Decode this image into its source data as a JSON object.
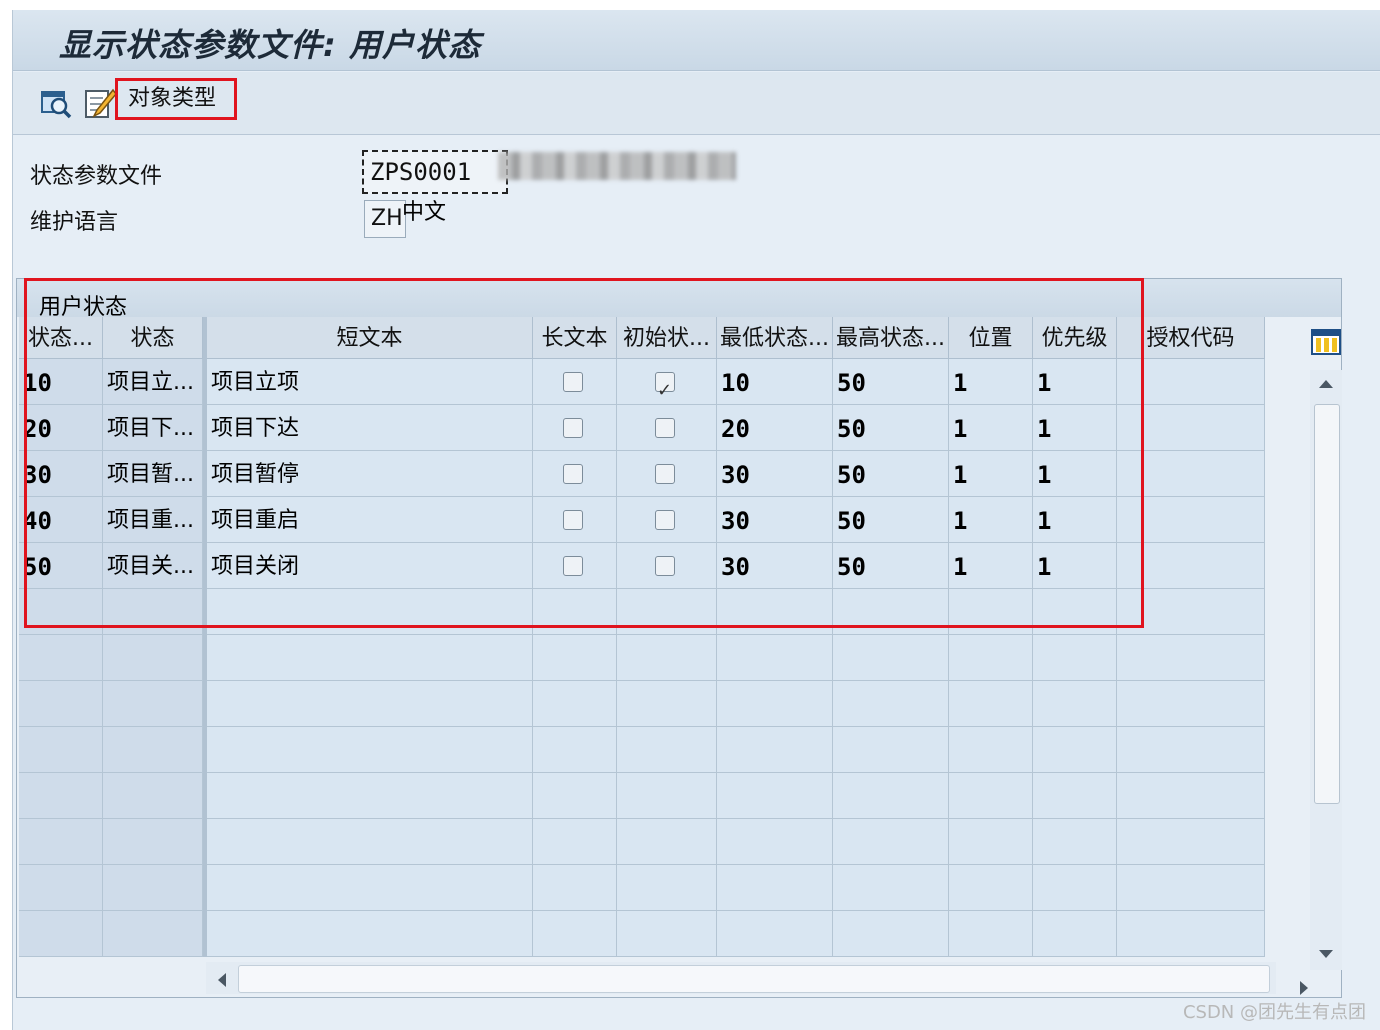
{
  "window": {
    "title": "显示状态参数文件: 用户状态"
  },
  "toolbar": {
    "icons": [
      "display-search-icon",
      "edit-pencil-icon"
    ],
    "object_type_label": "对象类型"
  },
  "form": {
    "profile_label": "状态参数文件",
    "profile_value": "ZPS0001",
    "language_label": "维护语言",
    "language_code": "ZH",
    "language_text": "中文"
  },
  "table": {
    "title": "用户状态",
    "columns": [
      "状态...",
      "状态",
      "短文本",
      "长文本",
      "初始状...",
      "最低状态...",
      "最高状态...",
      "位置",
      "优先级",
      "授权代码"
    ],
    "rows": [
      {
        "status_no": "10",
        "status": "项目立...",
        "short_text": "项目立项",
        "long_text": false,
        "initial": true,
        "lowest": "10",
        "highest": "50",
        "position": "1",
        "priority": "1",
        "auth_code": ""
      },
      {
        "status_no": "20",
        "status": "项目下...",
        "short_text": "项目下达",
        "long_text": false,
        "initial": false,
        "lowest": "20",
        "highest": "50",
        "position": "1",
        "priority": "1",
        "auth_code": ""
      },
      {
        "status_no": "30",
        "status": "项目暂...",
        "short_text": "项目暂停",
        "long_text": false,
        "initial": false,
        "lowest": "30",
        "highest": "50",
        "position": "1",
        "priority": "1",
        "auth_code": ""
      },
      {
        "status_no": "40",
        "status": "项目重...",
        "short_text": "项目重启",
        "long_text": false,
        "initial": false,
        "lowest": "30",
        "highest": "50",
        "position": "1",
        "priority": "1",
        "auth_code": ""
      },
      {
        "status_no": "50",
        "status": "项目关...",
        "short_text": "项目关闭",
        "long_text": false,
        "initial": false,
        "lowest": "30",
        "highest": "50",
        "position": "1",
        "priority": "1",
        "auth_code": ""
      }
    ]
  },
  "watermark": "CSDN @团先生有点团",
  "colors": {
    "highlight": "#e0141e",
    "background": "#e6eef6"
  }
}
